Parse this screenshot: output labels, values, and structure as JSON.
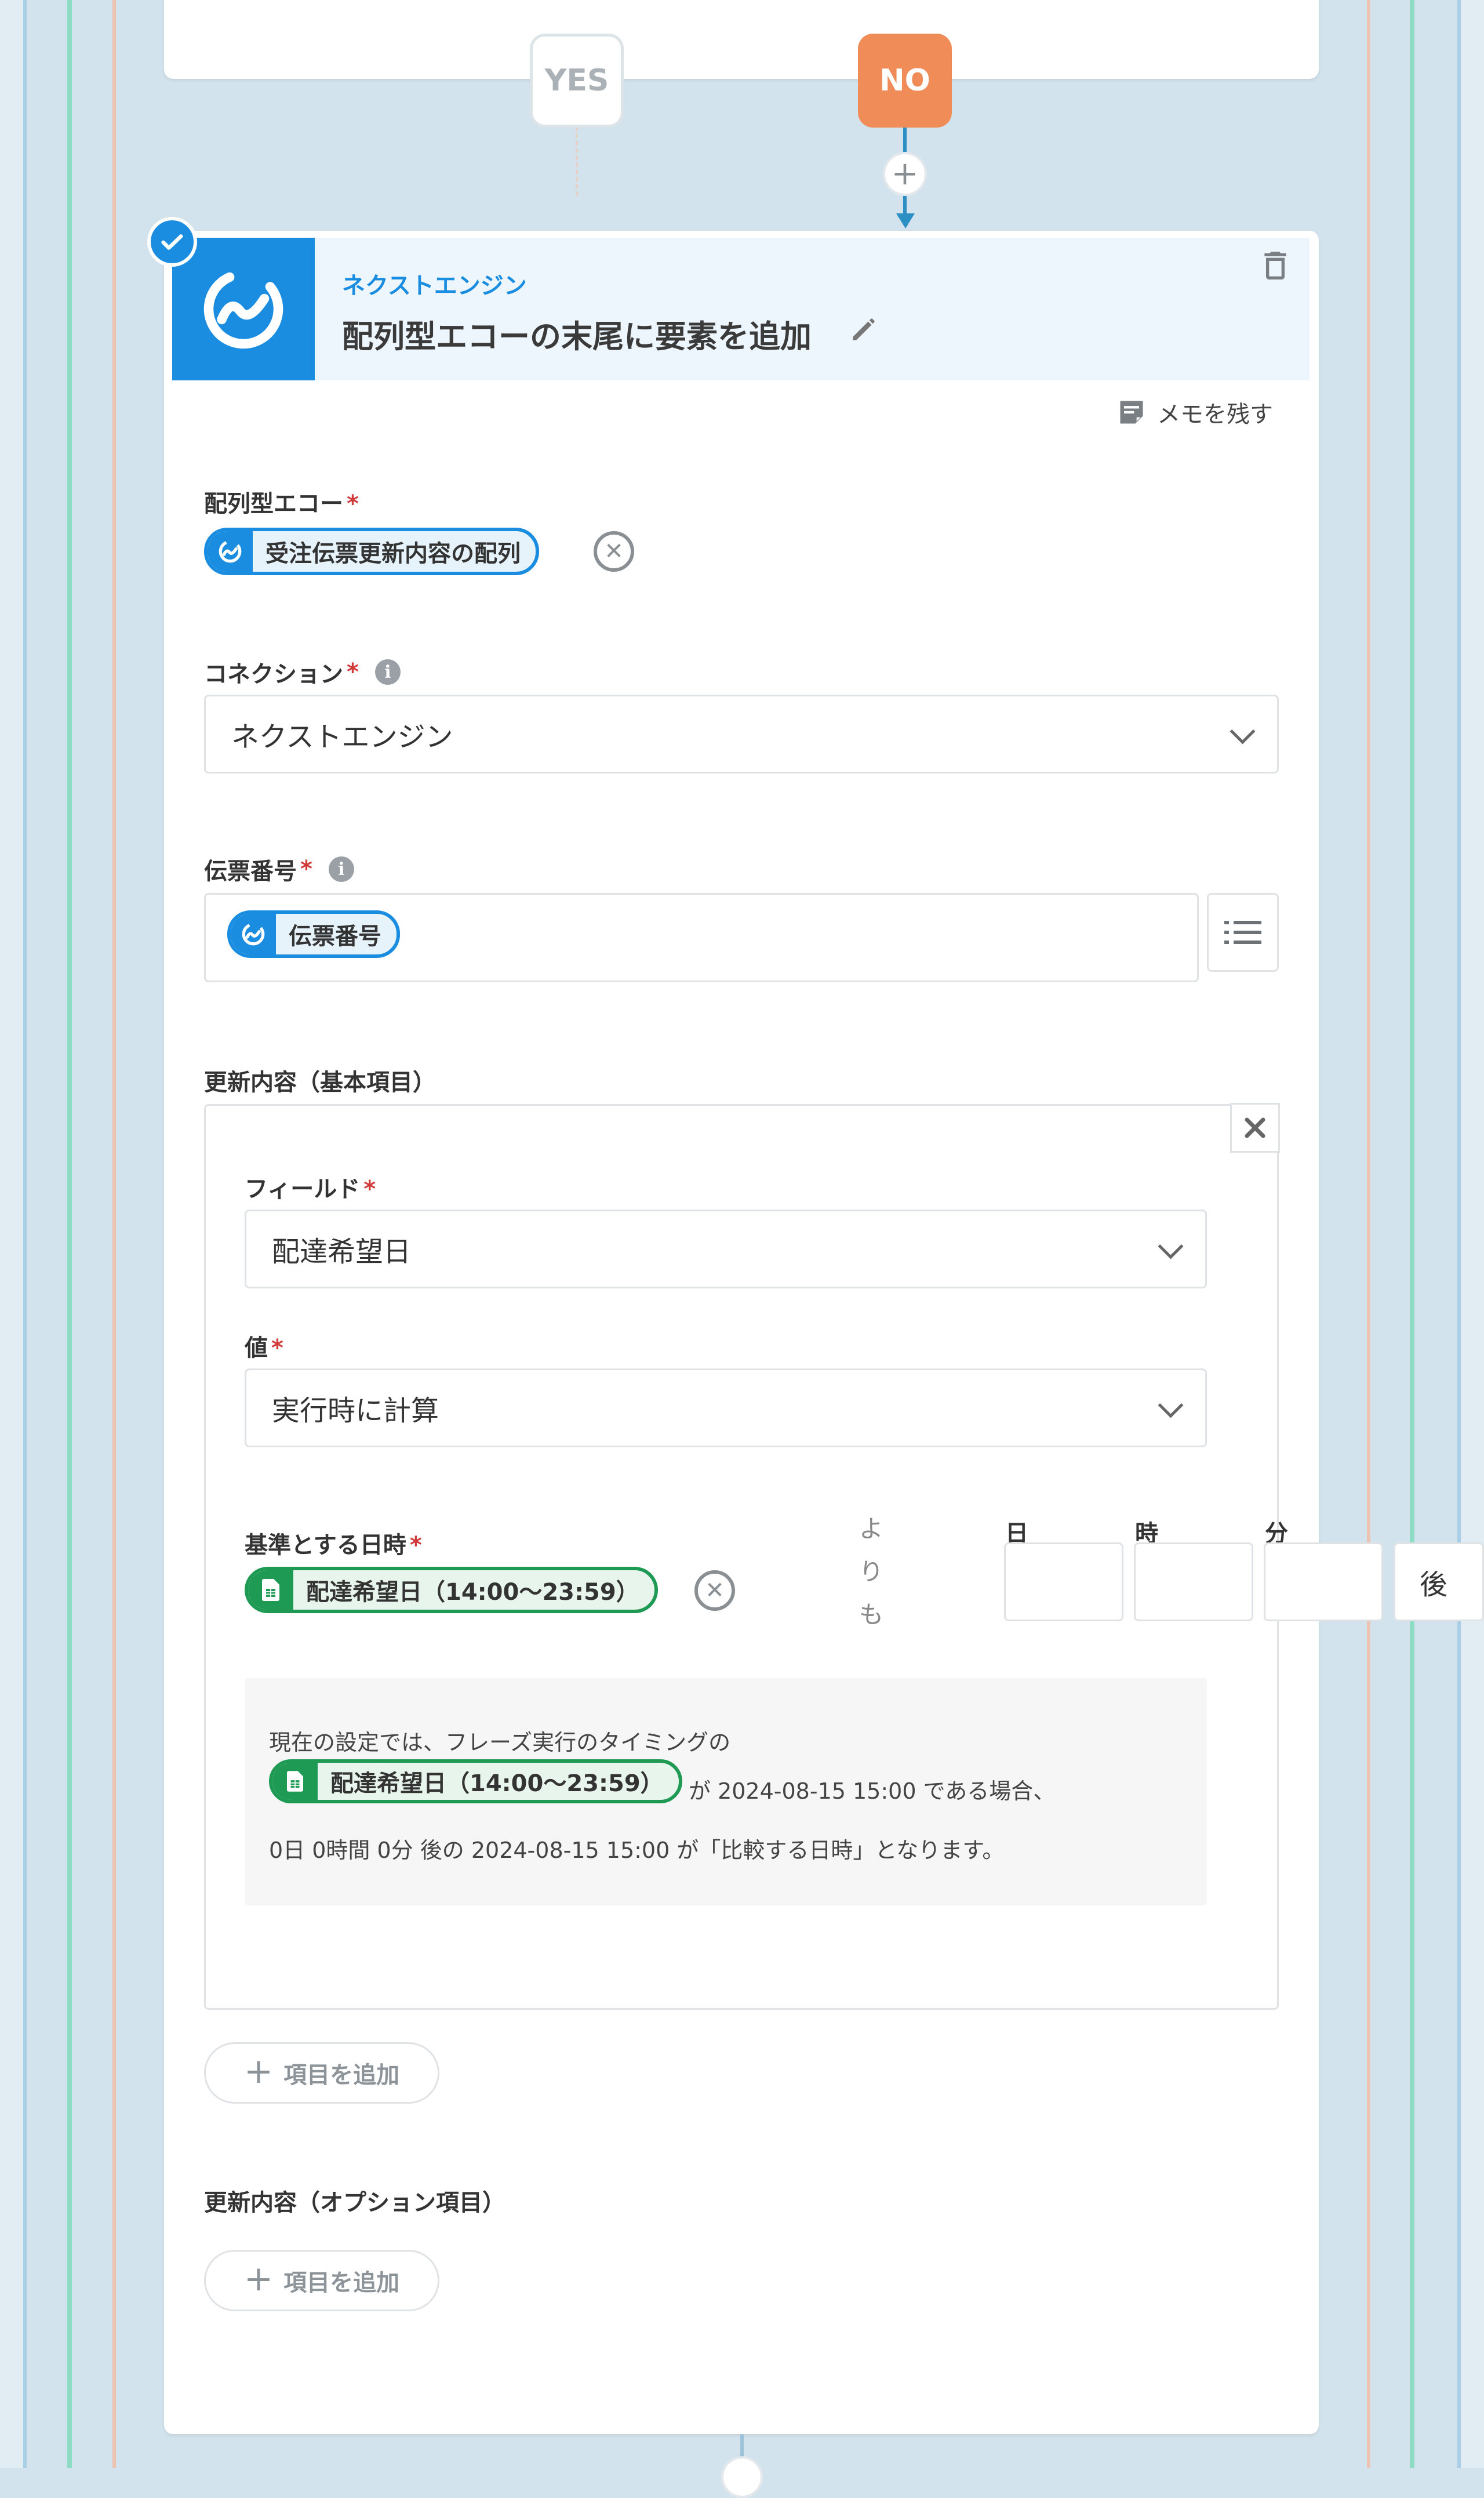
{
  "branches": {
    "yes": "YES",
    "no": "NO"
  },
  "step": {
    "app_name": "ネクストエンジン",
    "title": "配列型エコーの末尾に要素を追加",
    "memo_label": "メモを残す"
  },
  "fields": {
    "array_echo": {
      "label": "配列型エコー",
      "required_mark": "*",
      "pill": "受注伝票更新内容の配列"
    },
    "connection": {
      "label": "コネクション",
      "required_mark": "*",
      "value": "ネクストエンジン"
    },
    "slip_number": {
      "label": "伝票番号",
      "required_mark": "*",
      "pill": "伝票番号"
    },
    "basic_items": {
      "label": "更新内容（基本項目）",
      "field": {
        "label": "フィールド",
        "required_mark": "*",
        "value": "配達希望日"
      },
      "value": {
        "label": "値",
        "required_mark": "*",
        "value": "実行時に計算"
      },
      "base_datetime": {
        "label": "基準とする日時",
        "required_mark": "*",
        "pill": "配達希望日（14:00〜23:59）",
        "yorimo": [
          "よ",
          "り",
          "も"
        ],
        "units": [
          "日",
          "時",
          "分"
        ],
        "after": "後"
      },
      "preview": {
        "line1": "現在の設定では、フレーズ実行のタイミングの",
        "pill": "配達希望日（14:00〜23:59）",
        "line2_suffix": "が 2024-08-15 15:00 である場合、",
        "line3": "0日 0時間 0分 後の 2024-08-15 15:00 が「比較する日時」となります。"
      },
      "add_label": "項目を追加"
    },
    "option_items": {
      "label": "更新内容（オプション項目）",
      "add_label": "項目を追加"
    }
  },
  "colors": {
    "accent_blue": "#1a8de0",
    "no_orange": "#ef8c57",
    "sheet_green": "#1e9a55",
    "canvas": "#d3e3ed",
    "required_red": "#d23a3a"
  },
  "icons": [
    "check-circle-icon",
    "nextengine-logo-icon",
    "trash-icon",
    "pencil-icon",
    "memo-icon",
    "info-icon",
    "clear-icon",
    "chevron-down-icon",
    "list-icon",
    "close-icon",
    "spreadsheet-icon",
    "plus-icon"
  ]
}
